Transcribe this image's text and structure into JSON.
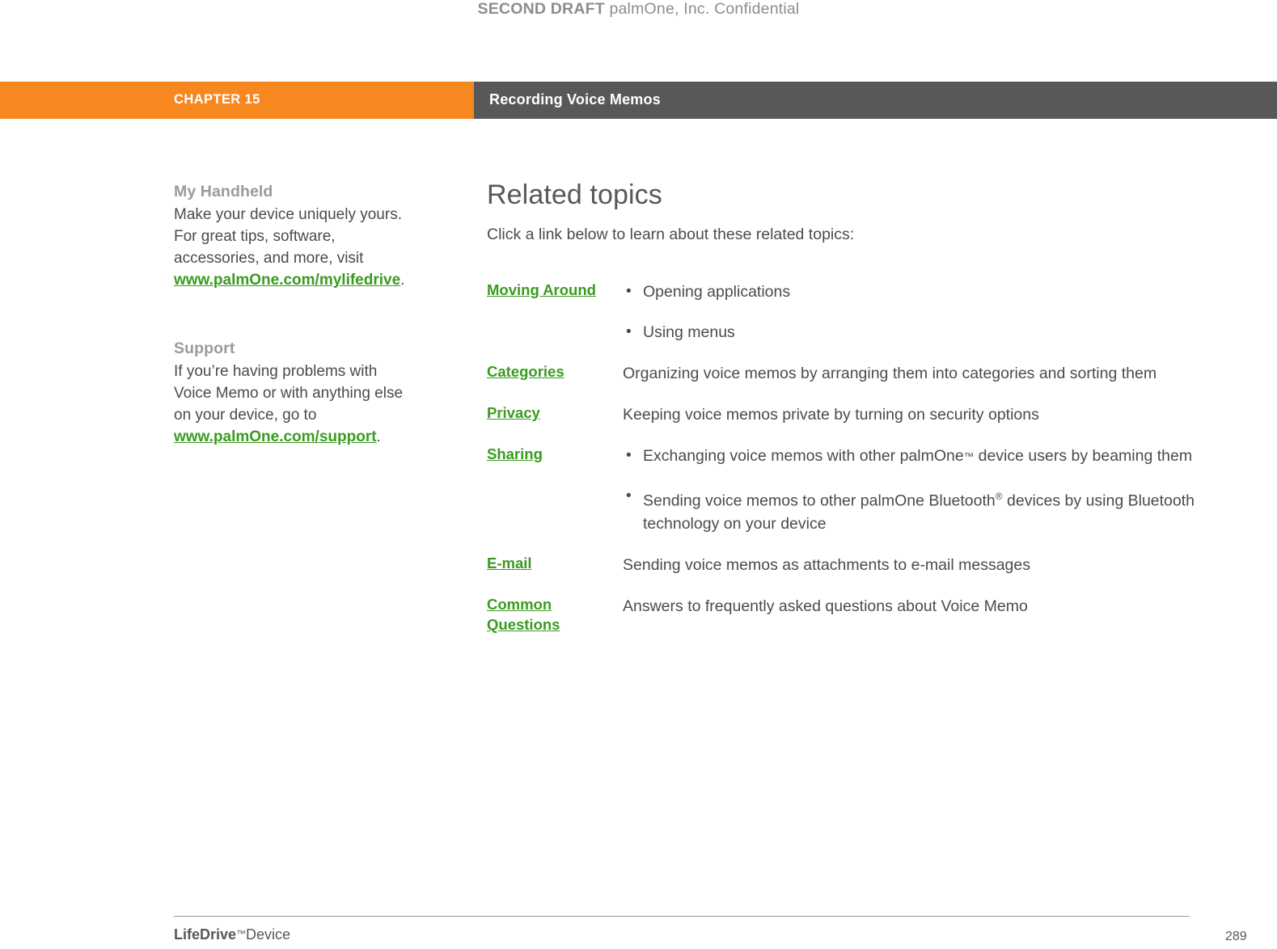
{
  "watermark": {
    "strong": "SECOND DRAFT",
    "rest": "palmOne, Inc.  Confidential"
  },
  "header": {
    "chapter_label": "CHAPTER 15",
    "chapter_title": "Recording Voice Memos",
    "orange_hex": "#F6881F",
    "gray_hex": "#58585A"
  },
  "sidebar": {
    "blocks": [
      {
        "heading": "My Handheld",
        "text_before": "Make your device uniquely yours. For great tips, software, accessories, and more, visit ",
        "link": "www.palmOne.com/mylifedrive",
        "text_after": "."
      },
      {
        "heading": "Support",
        "text_before": "If you’re having problems with Voice Memo or with anything else on your device, go to ",
        "link": "www.palmOne.com/support",
        "text_after": "."
      }
    ]
  },
  "main": {
    "title": "Related topics",
    "intro": "Click a link below to learn about these related topics:",
    "rows": [
      {
        "label": "Moving Around",
        "bullets": [
          "Opening applications",
          "Using menus"
        ],
        "desc": ""
      },
      {
        "label": "Categories",
        "bullets": [],
        "desc": "Organizing voice memos by arranging them into categories and sorting them"
      },
      {
        "label": "Privacy",
        "bullets": [],
        "desc": "Keeping voice memos private by turning on security options"
      },
      {
        "label": "Sharing",
        "bullets": [
          "Exchanging voice memos with other palmOne™ device users by beaming them",
          "Sending voice memos to other palmOne Bluetooth® devices by using Bluetooth technology on your device"
        ],
        "desc": ""
      },
      {
        "label": "E-mail",
        "bullets": [],
        "desc": "Sending voice memos as attachments to e-mail messages"
      },
      {
        "label": "Common Questions",
        "bullets": [],
        "desc": "Answers to frequently asked questions about Voice Memo"
      }
    ]
  },
  "footer": {
    "brand": "LifeDrive",
    "brand_tm": "™",
    "product": "Device",
    "page_number": "289"
  },
  "colors": {
    "green_link": "#3A9B1F",
    "body_text": "#4B4B4B",
    "muted_heading": "#9A9A9A"
  }
}
